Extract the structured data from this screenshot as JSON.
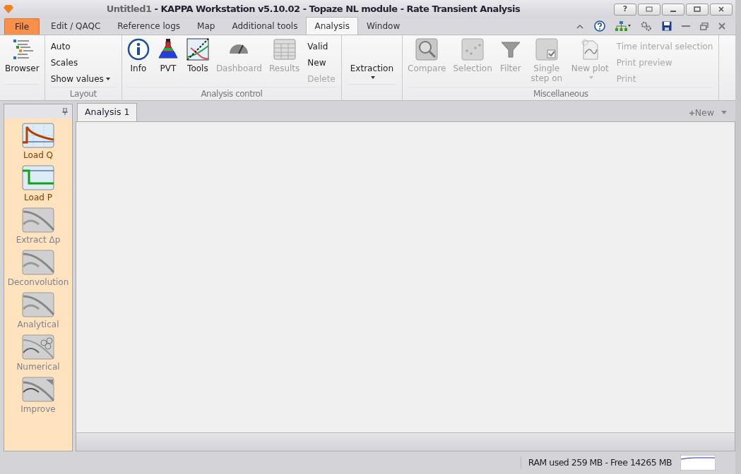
{
  "window": {
    "document": "Untitled1",
    "title": " - KAPPA Workstation v5.10.02 - Topaze NL module - Rate Transient Analysis",
    "help_key": "?"
  },
  "menu_tabs": [
    {
      "label": "File",
      "kind": "file",
      "selected": false
    },
    {
      "label": "Edit / QAQC",
      "kind": "tab",
      "selected": false
    },
    {
      "label": "Reference logs",
      "kind": "tab",
      "selected": false
    },
    {
      "label": "Map",
      "kind": "tab",
      "selected": false
    },
    {
      "label": "Additional tools",
      "kind": "tab",
      "selected": false
    },
    {
      "label": "Analysis",
      "kind": "tab",
      "selected": true
    },
    {
      "label": "Window",
      "kind": "tab",
      "selected": false
    }
  ],
  "ribbon": [
    {
      "items": [
        {
          "label": "Browser",
          "kind": "large",
          "disabled": false
        }
      ]
    },
    {
      "label": "Layout",
      "items": [
        {
          "label": "Auto",
          "kind": "small",
          "disabled": false
        },
        {
          "label": "Scales",
          "kind": "small",
          "disabled": false
        },
        {
          "label": "Show values",
          "kind": "small",
          "disabled": false,
          "dropdown": true
        }
      ]
    },
    {
      "label": "Analysis control",
      "items": [
        {
          "label": "Info",
          "kind": "large",
          "disabled": false
        },
        {
          "label": "PVT",
          "kind": "large",
          "disabled": false
        },
        {
          "label": "Tools",
          "kind": "large",
          "disabled": false
        },
        {
          "label": "Dashboard",
          "kind": "large",
          "disabled": true
        },
        {
          "label": "Results",
          "kind": "large",
          "disabled": true
        },
        {
          "kind": "stack",
          "items": [
            {
              "label": "Valid",
              "disabled": false
            },
            {
              "label": "New",
              "disabled": false
            },
            {
              "label": "Delete",
              "disabled": true
            }
          ]
        }
      ]
    },
    {
      "items": [
        {
          "label": "Extraction",
          "kind": "large",
          "disabled": false,
          "dropdown": true
        }
      ]
    },
    {
      "label": "Miscellaneous",
      "items": [
        {
          "label": "Compare",
          "kind": "large",
          "disabled": true
        },
        {
          "label": "Selection",
          "kind": "large",
          "disabled": true
        },
        {
          "label": "Filter",
          "kind": "large",
          "disabled": true
        },
        {
          "label": "Single step on",
          "kind": "large",
          "disabled": true
        },
        {
          "label": "New plot",
          "kind": "large",
          "disabled": true,
          "dropdown": true
        },
        {
          "kind": "stack",
          "items": [
            {
              "label": "Time interval selection",
              "disabled": true
            },
            {
              "label": "Print preview",
              "disabled": true
            },
            {
              "label": "Print",
              "disabled": true
            }
          ]
        }
      ]
    }
  ],
  "tool_panel": [
    {
      "label": "Load Q",
      "disabled": false
    },
    {
      "label": "Load P",
      "disabled": false
    },
    {
      "label": "Extract Δp",
      "disabled": true
    },
    {
      "label": "Deconvolution",
      "disabled": true
    },
    {
      "label": "Analytical",
      "disabled": true
    },
    {
      "label": "Numerical",
      "disabled": true
    },
    {
      "label": "Improve",
      "disabled": true
    }
  ],
  "document_tabs": [
    {
      "label": "Analysis 1",
      "selected": true
    }
  ],
  "new_button": "New",
  "status_bar": {
    "memory": "RAM used 259 MB - Free 14265 MB"
  }
}
